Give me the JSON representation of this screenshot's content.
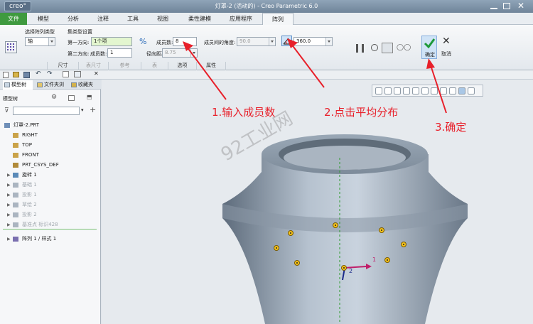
{
  "app": {
    "logo": "creo°",
    "window_title": "灯罩-2 (活动的) - Creo Parametric 6.0"
  },
  "menu": [
    "文件",
    "模型",
    "分析",
    "注释",
    "工具",
    "视图",
    "柔性建模",
    "应用程序",
    "阵列"
  ],
  "ribbon": {
    "pattern_type_label": "选择阵列类型",
    "pattern_type_value": "轴",
    "set_label": "集类型设置",
    "dir1_label": "第一方向:",
    "dir1_value": "1个项",
    "dir2_label": "第二方向:",
    "dir2_count_label": "成员数:",
    "dir2_count_value": "1",
    "members_label": "成员数:",
    "members_value": "8",
    "angle_label": "成员间的角度:",
    "angle_value": "90.0",
    "radial_label": "径向距离:",
    "radial_value": "8.75",
    "angle_range_value": "360.0",
    "ok_label": "确定",
    "cancel_label": "取消",
    "tabs": [
      "尺寸",
      "表尺寸",
      "参考",
      "表",
      "选项",
      "属性"
    ]
  },
  "panel": {
    "tab_model_tree": "模型树",
    "tab_folder": "文件夹浏",
    "tab_favorites": "收藏夹",
    "tree_title": "模型树",
    "tree_items": [
      {
        "label": "灯罩-2.PRT",
        "dim": false
      },
      {
        "label": "RIGHT",
        "dim": false
      },
      {
        "label": "TOP",
        "dim": false
      },
      {
        "label": "FRONT",
        "dim": false
      },
      {
        "label": "PRT_CSYS_DEF",
        "dim": false
      },
      {
        "label": "旋转 1",
        "dim": false
      },
      {
        "label": "基础 1",
        "dim": true
      },
      {
        "label": "投影 1",
        "dim": true
      },
      {
        "label": "草绘 2",
        "dim": true
      },
      {
        "label": "投影 2",
        "dim": true
      },
      {
        "label": "基准点 标识428",
        "dim": true
      },
      {
        "label": "阵列 1 / 样式 1",
        "dim": false
      }
    ]
  },
  "annotations": {
    "step1": "1.输入成员数",
    "step2": "2.点击平均分布",
    "step3": "3.确定",
    "watermark": "92工业网",
    "axis1": "1",
    "axis2": "2"
  },
  "colors": {
    "annotation": "#e8202a",
    "file_tab": "#3f9a3f",
    "ok_check": "#1e9a3a"
  }
}
